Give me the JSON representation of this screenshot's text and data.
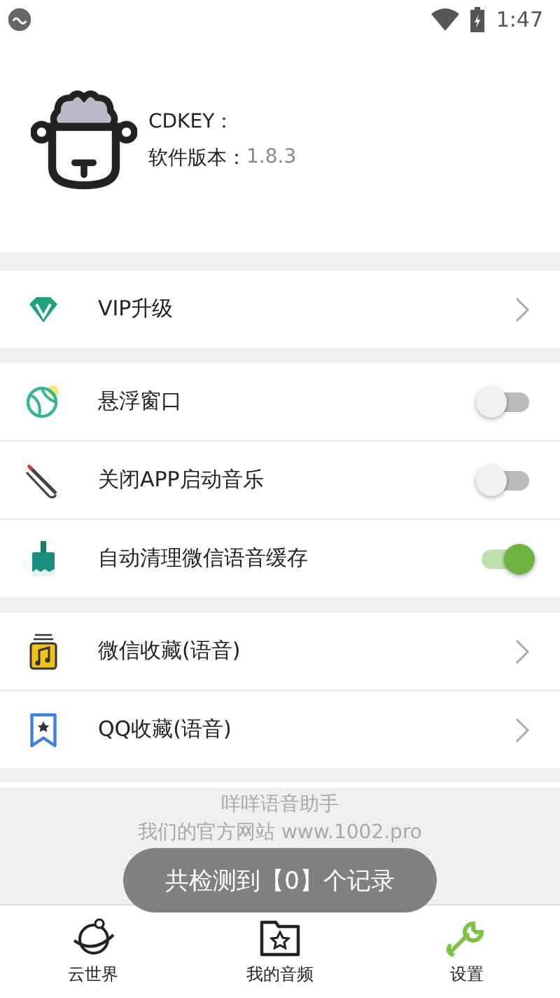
{
  "status_bar": {
    "time": "1:47"
  },
  "profile": {
    "cdkey_label": "CDKEY：",
    "version_label": "软件版本：",
    "version": "1.8.3"
  },
  "groups": [
    {
      "items": [
        {
          "kind": "link",
          "label": "VIP升级"
        }
      ]
    },
    {
      "items": [
        {
          "kind": "toggle",
          "label": "悬浮窗口",
          "on": false
        },
        {
          "kind": "toggle",
          "label": "关闭APP启动音乐",
          "on": false
        },
        {
          "kind": "toggle",
          "label": "自动清理微信语音缓存",
          "on": true
        }
      ]
    },
    {
      "items": [
        {
          "kind": "link",
          "label": "微信收藏(语音)"
        },
        {
          "kind": "link",
          "label": "QQ收藏(语音)"
        }
      ]
    }
  ],
  "footer": {
    "app_name": "咩咩语音助手",
    "website": "我们的官方网站 www.1002.pro"
  },
  "toast": "共检测到【0】个记录",
  "nav": [
    {
      "label": "云世界",
      "selected": false
    },
    {
      "label": "我的音频",
      "selected": false
    },
    {
      "label": "设置",
      "selected": true
    }
  ]
}
